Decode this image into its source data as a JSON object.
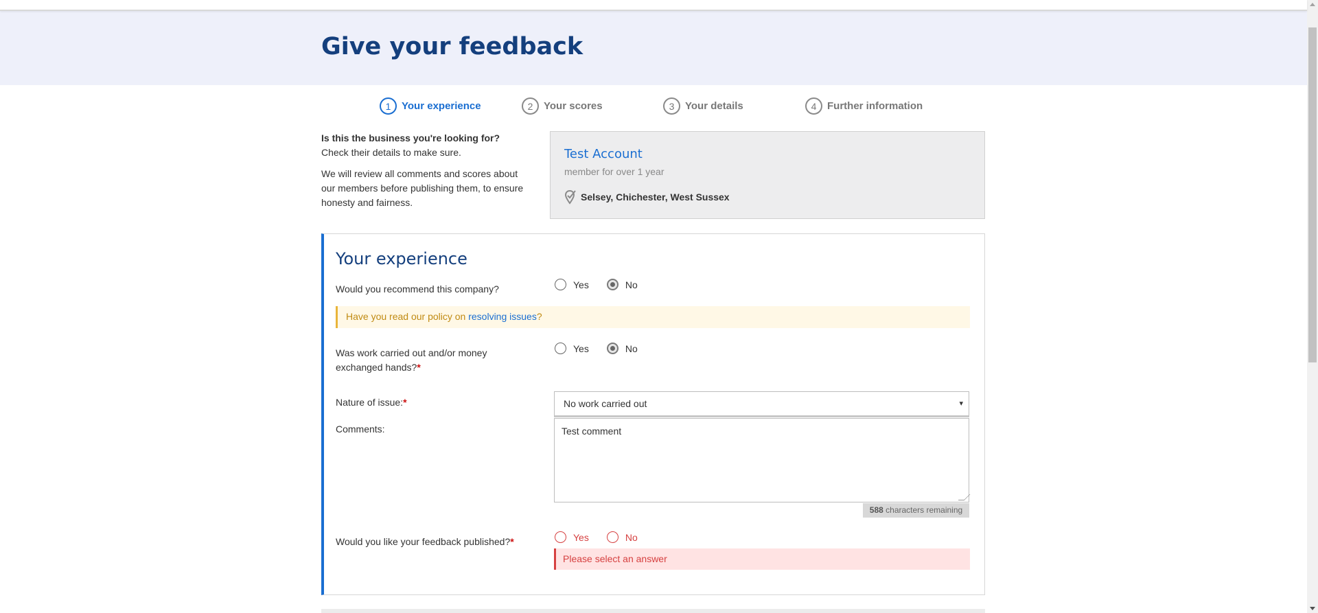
{
  "page": {
    "title": "Give your feedback"
  },
  "steps": [
    {
      "number": "1",
      "label": "Your experience",
      "active": true
    },
    {
      "number": "2",
      "label": "Your scores",
      "active": false
    },
    {
      "number": "3",
      "label": "Your details",
      "active": false
    },
    {
      "number": "4",
      "label": "Further information",
      "active": false
    }
  ],
  "intro": {
    "question": "Is this the business you're looking for?",
    "check": "Check their details to make sure.",
    "review": "We will review all comments and scores about our members before publishing them, to ensure honesty and fairness."
  },
  "business": {
    "name": "Test Account",
    "membership": "member for over 1 year",
    "location": "Selsey, Chichester, West Sussex",
    "location_icon": "map-pin-check-icon"
  },
  "experience": {
    "title": "Your experience",
    "recommend": {
      "question": "Would you recommend this company?",
      "options": [
        "Yes",
        "No"
      ],
      "selected": "No"
    },
    "notice": {
      "prefix": "Have you read our policy on ",
      "link": "resolving issues",
      "suffix": "?"
    },
    "work_carried": {
      "question_line1": "Was work carried out and/or money",
      "question_line2": "exchanged hands?",
      "required_mark": "*",
      "options": [
        "Yes",
        "No"
      ],
      "selected": "No"
    },
    "nature": {
      "label": "Nature of issue:",
      "required_mark": "*",
      "value": "No work carried out",
      "arrow": "▾"
    },
    "comments": {
      "label": "Comments:",
      "value": "Test comment",
      "remaining_count": "588",
      "remaining_text": " characters remaining"
    },
    "published": {
      "question": "Would you like your feedback published?",
      "required_mark": "*",
      "options": [
        "Yes",
        "No"
      ],
      "selected": null,
      "error": "Please select an answer"
    }
  },
  "colors": {
    "brand_blue": "#1a6ed1",
    "title_navy": "#143f7d",
    "header_band": "#eef0fa",
    "error_red": "#d64040",
    "notice_amber": "#c08a12"
  }
}
